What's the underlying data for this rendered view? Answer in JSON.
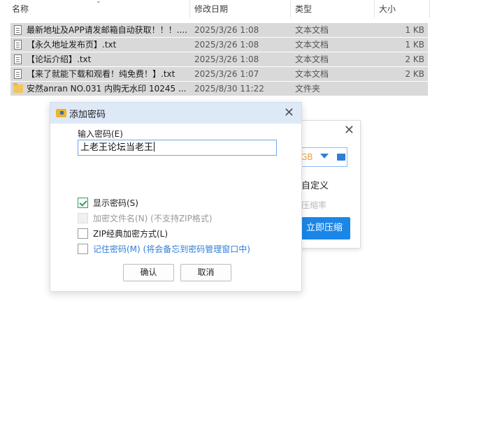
{
  "explorer": {
    "columns": {
      "name": "名称",
      "date": "修改日期",
      "type": "类型",
      "size": "大小"
    },
    "files": [
      {
        "name": "最新地址及APP请发邮箱自动获取！！！....",
        "date": "2025/3/26 1:08",
        "type": "文本文档",
        "size": "1 KB",
        "icon": "text-file-icon"
      },
      {
        "name": "【永久地址发布页】.txt",
        "date": "2025/3/26 1:08",
        "type": "文本文档",
        "size": "1 KB",
        "icon": "text-file-icon"
      },
      {
        "name": "【论坛介绍】.txt",
        "date": "2025/3/26 1:08",
        "type": "文本文档",
        "size": "2 KB",
        "icon": "text-file-icon"
      },
      {
        "name": "【来了就能下载和观看！纯免费！】.txt",
        "date": "2025/3/26 1:07",
        "type": "文本文档",
        "size": "2 KB",
        "icon": "text-file-icon"
      },
      {
        "name": "安然anran NO.031 内购无水印 10245 ...",
        "date": "2025/8/30 11:22",
        "type": "文件夹",
        "size": "",
        "icon": "folder-icon"
      }
    ]
  },
  "background_dialog": {
    "size_value": "GB",
    "option1": "自定义",
    "option2": "压缩率",
    "button": "立即压缩"
  },
  "dialog": {
    "title": "添加密码",
    "password_label": "输入密码(E)",
    "password_value": "上老王论坛当老王",
    "options": {
      "show_password": "显示密码(S)",
      "encrypt_filenames": "加密文件名(N) (不支持ZIP格式)",
      "zip_classic": "ZIP经典加密方式(L)",
      "remember_password": "记住密码(M) (将会备忘到密码管理窗口中)"
    },
    "ok_button": "确认",
    "cancel_button": "取消"
  },
  "colors": {
    "accent": "#1a86e8",
    "selection": "#d9d9d9",
    "title_bar": "#dde9f7",
    "check": "#2e9d5c"
  }
}
